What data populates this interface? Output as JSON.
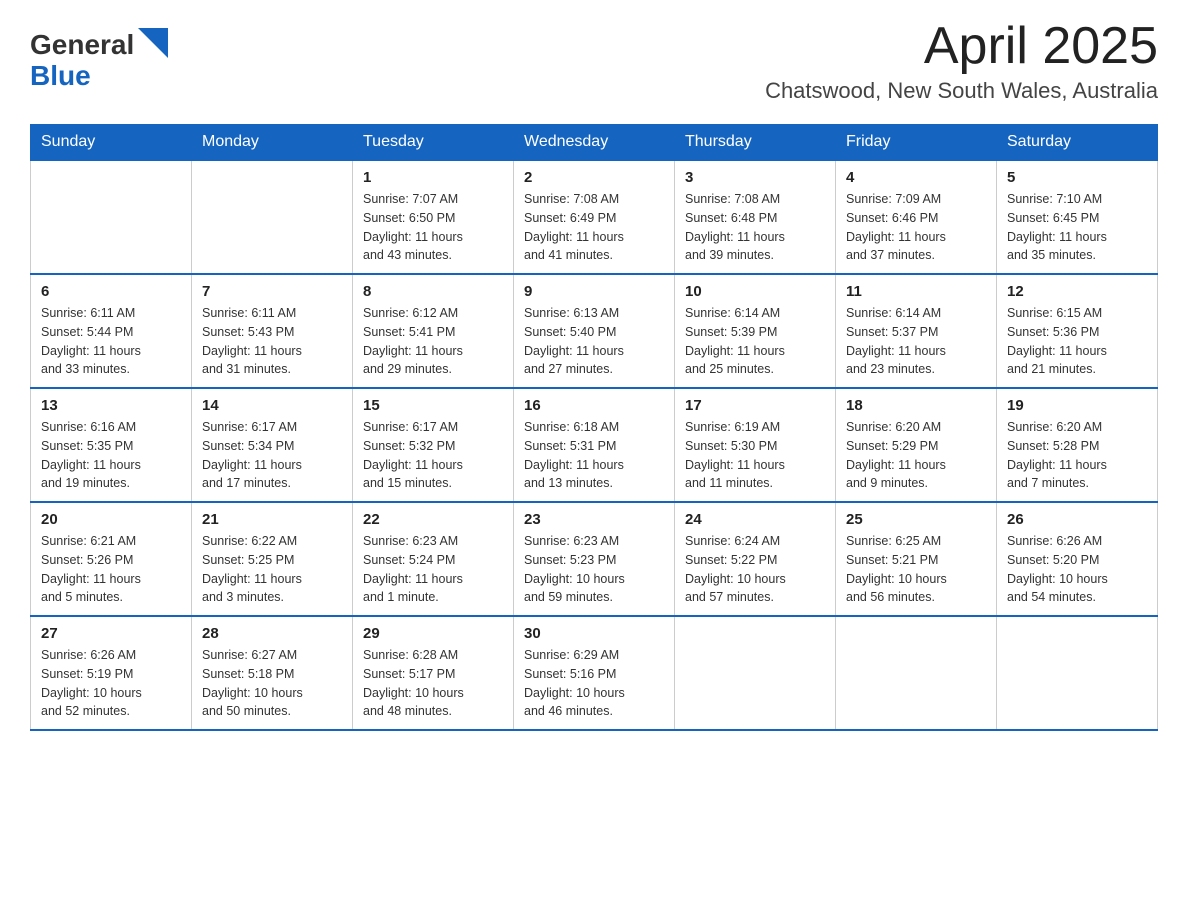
{
  "header": {
    "logo": {
      "general": "General",
      "blue": "Blue",
      "arrow_color": "#1565c0"
    },
    "title": "April 2025",
    "location": "Chatswood, New South Wales, Australia"
  },
  "calendar": {
    "days": [
      "Sunday",
      "Monday",
      "Tuesday",
      "Wednesday",
      "Thursday",
      "Friday",
      "Saturday"
    ],
    "weeks": [
      [
        {
          "day": "",
          "info": ""
        },
        {
          "day": "",
          "info": ""
        },
        {
          "day": "1",
          "info": "Sunrise: 7:07 AM\nSunset: 6:50 PM\nDaylight: 11 hours\nand 43 minutes."
        },
        {
          "day": "2",
          "info": "Sunrise: 7:08 AM\nSunset: 6:49 PM\nDaylight: 11 hours\nand 41 minutes."
        },
        {
          "day": "3",
          "info": "Sunrise: 7:08 AM\nSunset: 6:48 PM\nDaylight: 11 hours\nand 39 minutes."
        },
        {
          "day": "4",
          "info": "Sunrise: 7:09 AM\nSunset: 6:46 PM\nDaylight: 11 hours\nand 37 minutes."
        },
        {
          "day": "5",
          "info": "Sunrise: 7:10 AM\nSunset: 6:45 PM\nDaylight: 11 hours\nand 35 minutes."
        }
      ],
      [
        {
          "day": "6",
          "info": "Sunrise: 6:11 AM\nSunset: 5:44 PM\nDaylight: 11 hours\nand 33 minutes."
        },
        {
          "day": "7",
          "info": "Sunrise: 6:11 AM\nSunset: 5:43 PM\nDaylight: 11 hours\nand 31 minutes."
        },
        {
          "day": "8",
          "info": "Sunrise: 6:12 AM\nSunset: 5:41 PM\nDaylight: 11 hours\nand 29 minutes."
        },
        {
          "day": "9",
          "info": "Sunrise: 6:13 AM\nSunset: 5:40 PM\nDaylight: 11 hours\nand 27 minutes."
        },
        {
          "day": "10",
          "info": "Sunrise: 6:14 AM\nSunset: 5:39 PM\nDaylight: 11 hours\nand 25 minutes."
        },
        {
          "day": "11",
          "info": "Sunrise: 6:14 AM\nSunset: 5:37 PM\nDaylight: 11 hours\nand 23 minutes."
        },
        {
          "day": "12",
          "info": "Sunrise: 6:15 AM\nSunset: 5:36 PM\nDaylight: 11 hours\nand 21 minutes."
        }
      ],
      [
        {
          "day": "13",
          "info": "Sunrise: 6:16 AM\nSunset: 5:35 PM\nDaylight: 11 hours\nand 19 minutes."
        },
        {
          "day": "14",
          "info": "Sunrise: 6:17 AM\nSunset: 5:34 PM\nDaylight: 11 hours\nand 17 minutes."
        },
        {
          "day": "15",
          "info": "Sunrise: 6:17 AM\nSunset: 5:32 PM\nDaylight: 11 hours\nand 15 minutes."
        },
        {
          "day": "16",
          "info": "Sunrise: 6:18 AM\nSunset: 5:31 PM\nDaylight: 11 hours\nand 13 minutes."
        },
        {
          "day": "17",
          "info": "Sunrise: 6:19 AM\nSunset: 5:30 PM\nDaylight: 11 hours\nand 11 minutes."
        },
        {
          "day": "18",
          "info": "Sunrise: 6:20 AM\nSunset: 5:29 PM\nDaylight: 11 hours\nand 9 minutes."
        },
        {
          "day": "19",
          "info": "Sunrise: 6:20 AM\nSunset: 5:28 PM\nDaylight: 11 hours\nand 7 minutes."
        }
      ],
      [
        {
          "day": "20",
          "info": "Sunrise: 6:21 AM\nSunset: 5:26 PM\nDaylight: 11 hours\nand 5 minutes."
        },
        {
          "day": "21",
          "info": "Sunrise: 6:22 AM\nSunset: 5:25 PM\nDaylight: 11 hours\nand 3 minutes."
        },
        {
          "day": "22",
          "info": "Sunrise: 6:23 AM\nSunset: 5:24 PM\nDaylight: 11 hours\nand 1 minute."
        },
        {
          "day": "23",
          "info": "Sunrise: 6:23 AM\nSunset: 5:23 PM\nDaylight: 10 hours\nand 59 minutes."
        },
        {
          "day": "24",
          "info": "Sunrise: 6:24 AM\nSunset: 5:22 PM\nDaylight: 10 hours\nand 57 minutes."
        },
        {
          "day": "25",
          "info": "Sunrise: 6:25 AM\nSunset: 5:21 PM\nDaylight: 10 hours\nand 56 minutes."
        },
        {
          "day": "26",
          "info": "Sunrise: 6:26 AM\nSunset: 5:20 PM\nDaylight: 10 hours\nand 54 minutes."
        }
      ],
      [
        {
          "day": "27",
          "info": "Sunrise: 6:26 AM\nSunset: 5:19 PM\nDaylight: 10 hours\nand 52 minutes."
        },
        {
          "day": "28",
          "info": "Sunrise: 6:27 AM\nSunset: 5:18 PM\nDaylight: 10 hours\nand 50 minutes."
        },
        {
          "day": "29",
          "info": "Sunrise: 6:28 AM\nSunset: 5:17 PM\nDaylight: 10 hours\nand 48 minutes."
        },
        {
          "day": "30",
          "info": "Sunrise: 6:29 AM\nSunset: 5:16 PM\nDaylight: 10 hours\nand 46 minutes."
        },
        {
          "day": "",
          "info": ""
        },
        {
          "day": "",
          "info": ""
        },
        {
          "day": "",
          "info": ""
        }
      ]
    ]
  }
}
